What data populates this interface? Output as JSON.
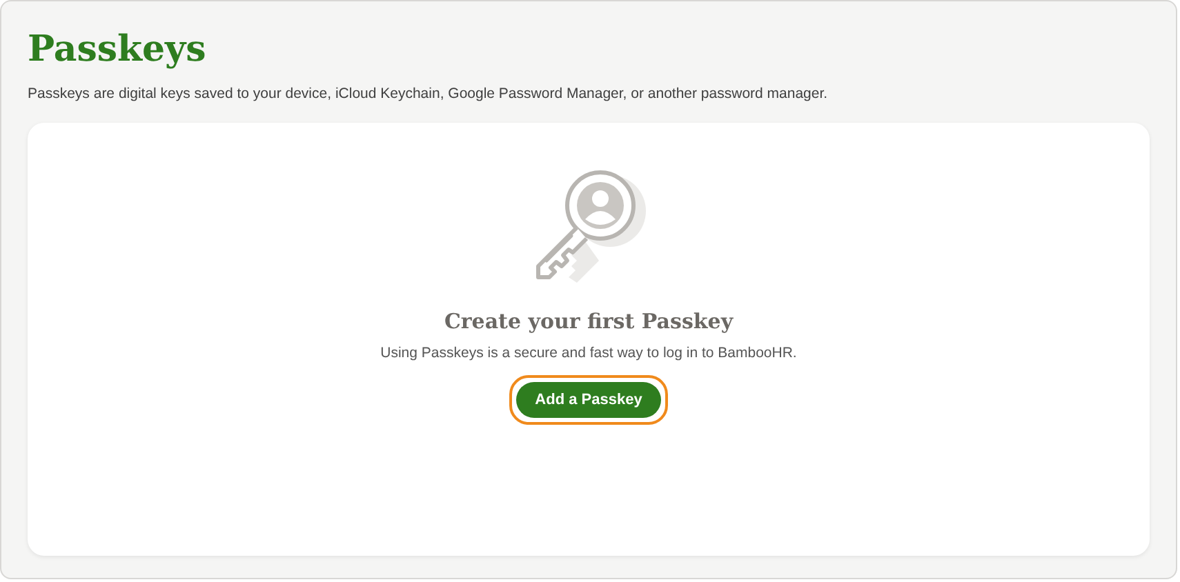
{
  "page": {
    "title": "Passkeys",
    "description": "Passkeys are digital keys saved to your device, iCloud Keychain, Google Password Manager, or another password manager."
  },
  "empty_state": {
    "heading": "Create your first Passkey",
    "text": "Using Passkeys is a secure and fast way to log in to BambooHR.",
    "button": {
      "label": "Add a Passkey",
      "focused": true
    }
  }
}
